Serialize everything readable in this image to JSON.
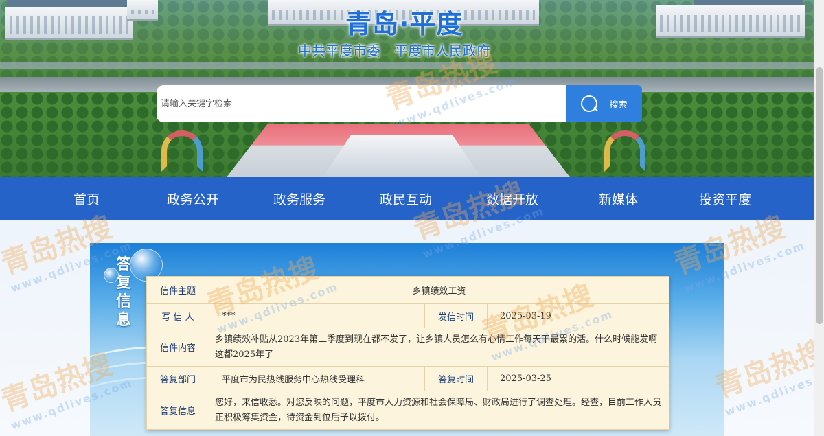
{
  "header": {
    "title": "青岛·平度",
    "subtitle": "中共平度市委　平度市人民政府",
    "search": {
      "placeholder": "请输入关键字检索",
      "button_label": "搜索"
    }
  },
  "nav": {
    "items": [
      "首页",
      "政务公开",
      "政务服务",
      "政民互动",
      "数据开放",
      "新媒体",
      "投资平度"
    ]
  },
  "panel": {
    "label_chars": [
      "答",
      "复",
      "信",
      "息"
    ]
  },
  "letter": {
    "subject_label": "信件主题",
    "subject": "乡镇绩效工资",
    "writer_label": "写 信 人",
    "writer": "***",
    "sent_label": "发信时间",
    "sent_time": "2025-03-19",
    "content_label": "信件内容",
    "content": "乡镇绩效补贴从2023年第二季度到现在都不发了，让乡镇人员怎么有心情工作每天干最累的活。什么时候能发啊这都2025年了",
    "dept_label": "答复部门",
    "dept": "平度市为民热线服务中心热线受理科",
    "reply_time_label": "答复时间",
    "reply_time": "2025-03-25",
    "reply_label": "答复信息",
    "reply": "您好，来信收悉。对您反映的问题，平度市人力资源和社会保障局、财政局进行了调查处理。经查，目前工作人员正积极筹集资金，待资金到位后予以拨付。"
  },
  "watermark": {
    "text": "青岛热搜",
    "url": "www.qdlives.com"
  },
  "colors": {
    "nav_bg": "#2563c8",
    "search_button": "#2f80de",
    "table_bg": "#fcf4dc",
    "label_text": "#1a3d7c"
  }
}
